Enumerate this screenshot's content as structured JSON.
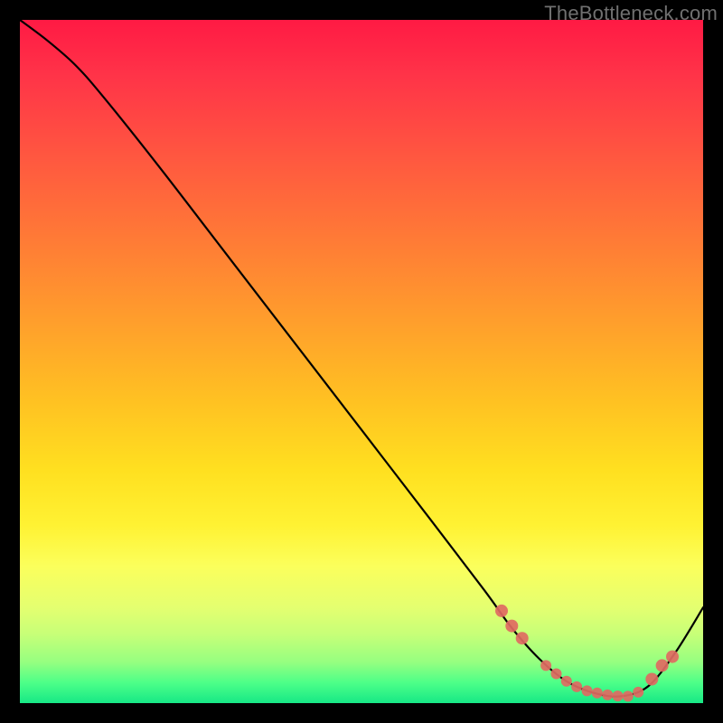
{
  "watermark": "TheBottleneck.com",
  "chart_data": {
    "type": "line",
    "title": "",
    "xlabel": "",
    "ylabel": "",
    "xlim": [
      0,
      100
    ],
    "ylim": [
      0,
      100
    ],
    "series": [
      {
        "name": "curve",
        "x": [
          0,
          4,
          8,
          12,
          20,
          30,
          40,
          50,
          60,
          68,
          72,
          76,
          80,
          84,
          88,
          92,
          96,
          100
        ],
        "y": [
          100,
          97,
          93.5,
          89,
          79,
          66,
          53,
          40,
          27,
          16.5,
          11,
          6.5,
          3.2,
          1.5,
          1.0,
          2.5,
          7.5,
          14
        ]
      }
    ],
    "markers": {
      "name": "highlight-dots",
      "x": [
        70.5,
        72.0,
        73.5,
        77.0,
        78.5,
        80.0,
        81.5,
        83.0,
        84.5,
        86.0,
        87.5,
        89.0,
        90.5,
        92.5,
        94.0,
        95.5
      ],
      "y": [
        13.5,
        11.3,
        9.5,
        5.5,
        4.3,
        3.2,
        2.4,
        1.8,
        1.5,
        1.2,
        1.05,
        1.0,
        1.6,
        3.5,
        5.5,
        6.8
      ],
      "r": [
        7,
        7,
        7,
        6,
        6,
        6,
        6,
        6,
        6,
        6,
        6,
        6,
        6,
        7,
        7,
        7
      ]
    }
  }
}
